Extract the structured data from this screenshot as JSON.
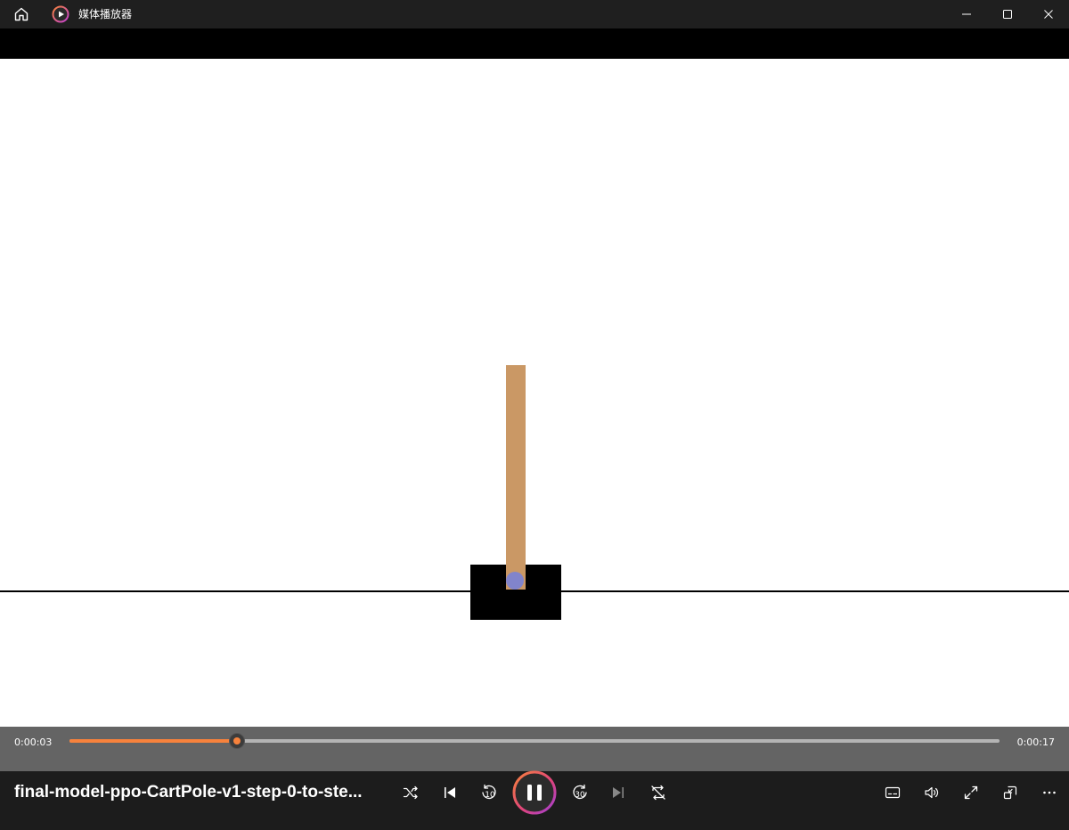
{
  "window": {
    "title": "媒体播放器",
    "buttons": [
      "minimize",
      "maximize",
      "close"
    ]
  },
  "titlebar_icons": {
    "home": "home-icon",
    "app": "media-player-app-icon"
  },
  "scene": {
    "description_objects": [
      "ground-line",
      "cart",
      "pole",
      "axle"
    ],
    "colors": {
      "background": "#ffffff",
      "cart": "#000000",
      "pole": "#ca9865",
      "axle": "#8184cb",
      "ground": "#000000"
    }
  },
  "player": {
    "current_time": "0:00:03",
    "total_time": "0:00:17",
    "progress": 0.18,
    "accent_color": "#f7823c",
    "media_title": "final-model-ppo-CartPole-v1-step-0-to-ste..."
  },
  "controls": {
    "left": [
      {
        "name": "shuffle-icon"
      },
      {
        "name": "previous-icon"
      },
      {
        "name": "skip-back-10-icon",
        "label": "10"
      },
      {
        "name": "pause-icon"
      },
      {
        "name": "skip-forward-30-icon",
        "label": "30"
      },
      {
        "name": "next-icon"
      },
      {
        "name": "repeat-off-icon"
      }
    ],
    "right": [
      {
        "name": "subtitles-icon"
      },
      {
        "name": "volume-icon"
      },
      {
        "name": "fullscreen-icon"
      },
      {
        "name": "mini-player-icon"
      },
      {
        "name": "more-options-icon"
      }
    ]
  }
}
